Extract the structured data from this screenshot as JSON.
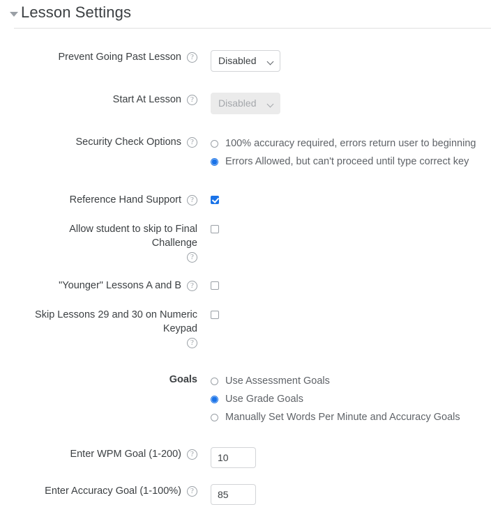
{
  "section": {
    "title": "Lesson Settings",
    "collapse_icon": "caret-down-icon",
    "expanded": true
  },
  "help_glyph": "?",
  "rows": {
    "prevent_going_past_lesson": {
      "label": "Prevent Going Past Lesson",
      "value": "Disabled",
      "disabled": false
    },
    "start_at_lesson": {
      "label": "Start At Lesson",
      "value": "Disabled",
      "disabled": true
    },
    "security_check_options": {
      "label": "Security Check Options",
      "options": [
        "100% accuracy required, errors return user to beginning",
        "Errors Allowed, but can't proceed until type correct key"
      ],
      "selected_index": 1
    },
    "reference_hand_support": {
      "label": "Reference Hand Support",
      "checked": true
    },
    "allow_skip_final_challenge": {
      "label_line1": "Allow student to skip to Final",
      "label_line2": "Challenge",
      "checked": false
    },
    "younger_lessons": {
      "label": "\"Younger\" Lessons A and B",
      "checked": false
    },
    "skip_lessons_numeric_keypad": {
      "label_line1": "Skip Lessons 29 and 30 on Numeric",
      "label_line2": "Keypad",
      "checked": false
    },
    "goals": {
      "label": "Goals",
      "options": [
        "Use Assessment Goals",
        "Use Grade Goals",
        "Manually Set Words Per Minute and Accuracy Goals"
      ],
      "selected_index": 1
    },
    "wpm_goal": {
      "label": "Enter WPM Goal (1-200)",
      "value": "10"
    },
    "accuracy_goal": {
      "label": "Enter Accuracy Goal (1-100%)",
      "value": "85"
    }
  },
  "colors": {
    "accent": "#1a73e8",
    "text": "#3c4043",
    "muted_text": "#5f6368",
    "border": "#d2d4d7",
    "disabled_bg": "#ebebeb"
  }
}
